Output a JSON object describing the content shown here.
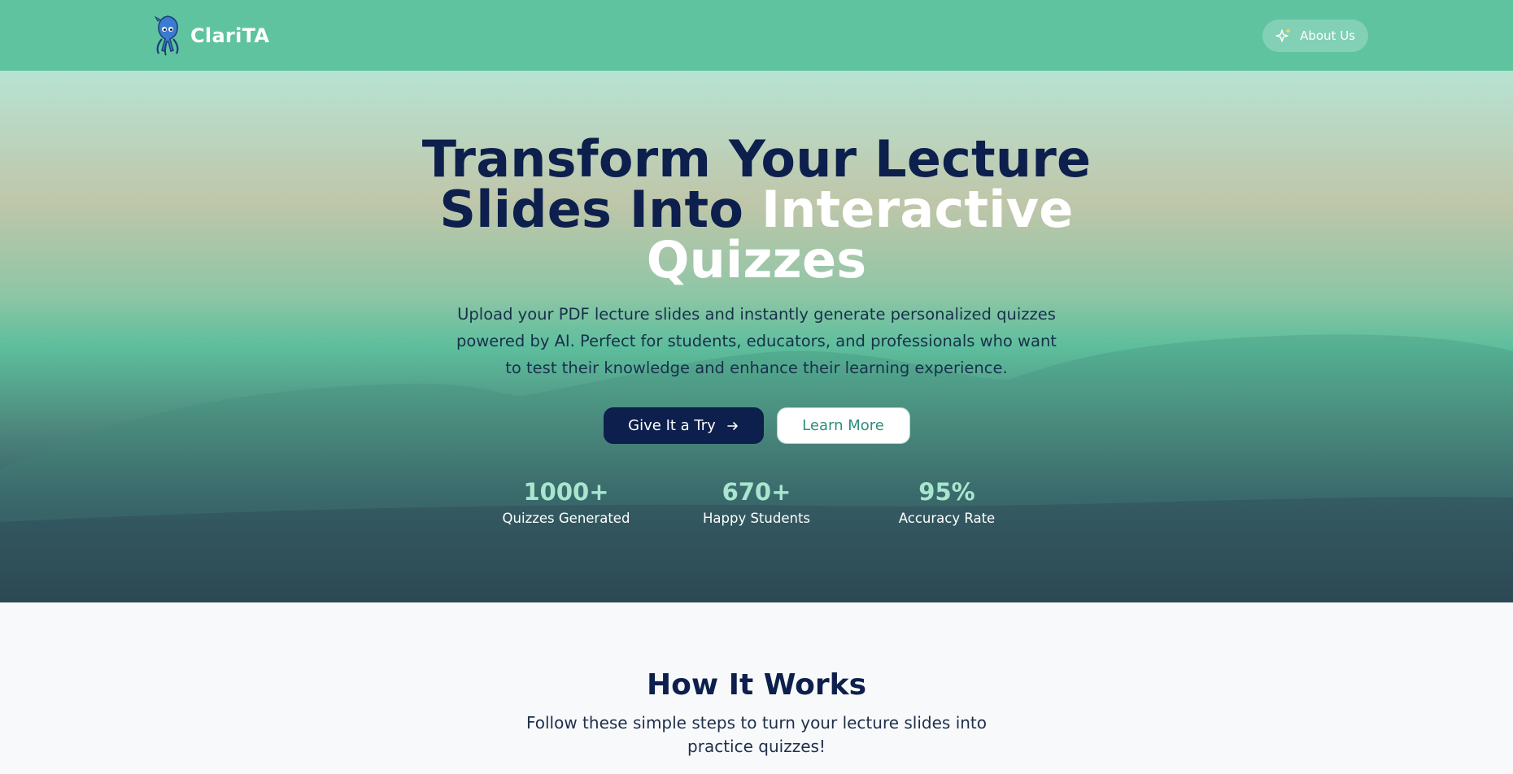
{
  "brand": {
    "name": "ClariTA",
    "logo_icon": "squid-mascot-icon"
  },
  "nav": {
    "about_label": "About Us",
    "about_icon": "sparkle-icon"
  },
  "hero": {
    "title_line1": "Transform Your Lecture",
    "title_line2_dark": "Slides Into ",
    "title_line2_light": "Interactive",
    "title_line3_light": "Quizzes",
    "subtitle": "Upload your PDF lecture slides and instantly generate personalized quizzes powered by AI. Perfect for students, educators, and professionals who want to test their knowledge and enhance their learning experience.",
    "primary_button": "Give It a Try",
    "secondary_button": "Learn More"
  },
  "stats": [
    {
      "value": "1000+",
      "label": "Quizzes Generated"
    },
    {
      "value": "670+",
      "label": "Happy Students"
    },
    {
      "value": "95%",
      "label": "Accuracy Rate"
    }
  ],
  "how": {
    "title": "How It Works",
    "subtitle": "Follow these simple steps to turn your lecture slides into practice quizzes!"
  },
  "colors": {
    "navbar": "#5fc3a0",
    "navy": "#0d1f4c",
    "mint": "#a8e6cf",
    "teal_text": "#2e8e7b"
  }
}
